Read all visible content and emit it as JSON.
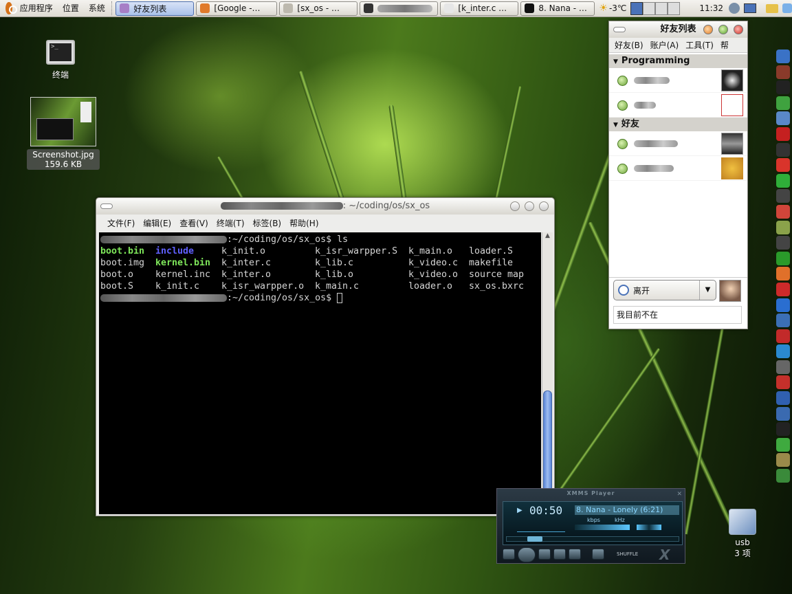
{
  "top_panel": {
    "menus": [
      "应用程序",
      "位置",
      "系统"
    ],
    "tasks": [
      {
        "label": "好友列表",
        "active": true,
        "icon": "pidgin-icon",
        "color": "#a77fc6"
      },
      {
        "label": "[Google -…",
        "active": false,
        "icon": "firefox-icon",
        "color": "#e07a2b"
      },
      {
        "label": "[sx_os - …",
        "active": false,
        "icon": "file-manager-icon",
        "color": "#bdb9ae"
      },
      {
        "label": "",
        "active": false,
        "icon": "terminal-icon",
        "color": "#333333"
      },
      {
        "label": "[k_inter.c …",
        "active": false,
        "icon": "gedit-icon",
        "color": "#e6e6e6"
      },
      {
        "label": "8. Nana - …",
        "active": false,
        "icon": "xmms-icon",
        "color": "#111111"
      }
    ],
    "weather": "-3℃",
    "clock": "11:32"
  },
  "desktop": {
    "terminal_icon_label": "终端",
    "screenshot_label": "Screenshot.jpg",
    "screenshot_size": "159.6 KB",
    "usb_label": "usb",
    "usb_items": "3 项"
  },
  "terminal": {
    "title": ": ~/coding/os/sx_os",
    "menu": [
      "文件(F)",
      "编辑(E)",
      "查看(V)",
      "终端(T)",
      "标签(B)",
      "帮助(H)"
    ],
    "prompt_suffix": ":~/coding/os/sx_os$",
    "command": "ls",
    "columns": [
      [
        {
          "t": "boot.bin",
          "c": "g"
        },
        {
          "t": "boot.img",
          "c": ""
        },
        {
          "t": "boot.o",
          "c": ""
        },
        {
          "t": "boot.S",
          "c": ""
        }
      ],
      [
        {
          "t": "include",
          "c": "b"
        },
        {
          "t": "kernel.bin",
          "c": "g"
        },
        {
          "t": "kernel.inc",
          "c": ""
        },
        {
          "t": "k_init.c",
          "c": ""
        }
      ],
      [
        {
          "t": "k_init.o",
          "c": ""
        },
        {
          "t": "k_inter.c",
          "c": ""
        },
        {
          "t": "k_inter.o",
          "c": ""
        },
        {
          "t": "k_isr_warpper.o",
          "c": ""
        }
      ],
      [
        {
          "t": "k_isr_warpper.S",
          "c": ""
        },
        {
          "t": "k_lib.c",
          "c": ""
        },
        {
          "t": "k_lib.o",
          "c": ""
        },
        {
          "t": "k_main.c",
          "c": ""
        }
      ],
      [
        {
          "t": "k_main.o",
          "c": ""
        },
        {
          "t": "k_video.c",
          "c": ""
        },
        {
          "t": "k_video.o",
          "c": ""
        },
        {
          "t": "loader.o",
          "c": ""
        }
      ],
      [
        {
          "t": "loader.S",
          "c": ""
        },
        {
          "t": "makefile",
          "c": ""
        },
        {
          "t": "source map",
          "c": ""
        },
        {
          "t": "sx_os.bxrc",
          "c": ""
        }
      ]
    ]
  },
  "buddy_list": {
    "title": "好友列表",
    "menu": [
      "好友(B)",
      "账户(A)",
      "工具(T)",
      "帮"
    ],
    "groups": [
      {
        "name": "Programming"
      },
      {
        "name": "好友"
      }
    ],
    "status": "离开",
    "message": "我目前不在"
  },
  "xmms": {
    "title": "XMMS Player",
    "time": "00:50",
    "track": "8. Nana - Lonely (6:21)",
    "kbps_label": "kbps",
    "khz_label": "kHz",
    "shuffle": "SHUFFLE",
    "progress": 0.13
  },
  "dock_icons": [
    "network-icon",
    "panel-icon",
    "amazon-icon",
    "people-icon",
    "clock-icon",
    "smart-icon",
    "monitor-icon",
    "lifebuoy-icon",
    "equalizer-icon",
    "camera-icon",
    "pencil-icon",
    "book-icon",
    "x-icon",
    "arrow-icon",
    "firefox-icon",
    "pokeball-icon",
    "wave-icon",
    "python-icon",
    "pdf-icon",
    "sync-icon",
    "dice-icon",
    "acrobat-icon",
    "film-icon",
    "globe-icon",
    "terminal-icon",
    "skype-icon",
    "notes-icon",
    "vim-icon"
  ],
  "dock_colors": [
    "#3a72c6",
    "#8a3a2a",
    "#222222",
    "#3fa23f",
    "#5a88c9",
    "#c52020",
    "#333333",
    "#d9342b",
    "#2fae39",
    "#444444",
    "#d0453a",
    "#8aa24a",
    "#444444",
    "#2a9a2a",
    "#e0702a",
    "#cc2a2a",
    "#2a6ed0",
    "#3b6fb5",
    "#c22a2a",
    "#2a8ad0",
    "#666666",
    "#c4302b",
    "#3060b0",
    "#3a6ab0",
    "#222222",
    "#3faa3f",
    "#9a8a4a",
    "#3a8a3a"
  ]
}
